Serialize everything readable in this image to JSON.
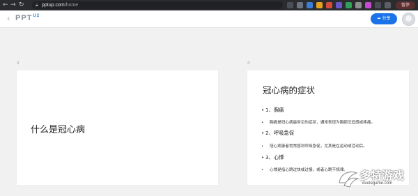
{
  "browser": {
    "url_host": "pptup.com",
    "url_path": "/home",
    "profile_label": "暂停"
  },
  "header": {
    "back_glyph": "‹",
    "logo_text": "PPT",
    "logo_suffix": "U2",
    "share_label": "➦ 分享"
  },
  "slides": [
    {
      "number": "3",
      "title": "什么是冠心病"
    },
    {
      "number": "4",
      "title": "冠心病的症状",
      "items": [
        {
          "label": "1、胸痛",
          "sub": "胸痛是冠心病最常见的症状，通常表现为胸部压迫感或疼痛。"
        },
        {
          "label": "2、呼吸急促",
          "sub": "冠心病患者常常感到呼吸急促，尤其是在运动或活动后。"
        },
        {
          "label": "3、心悸",
          "sub": "心悸是指心跳过快或过慢，或者心跳不规律。"
        }
      ]
    }
  ],
  "watermark": {
    "text": "多特游戏",
    "domain": "duotegame.com"
  }
}
